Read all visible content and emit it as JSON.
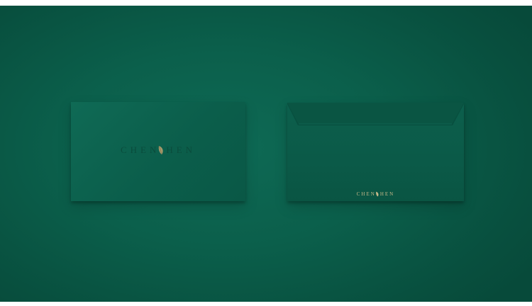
{
  "front_envelope": {
    "logo_left": "CHEN",
    "logo_right": "HEN"
  },
  "back_envelope": {
    "logo_left": "CHEN",
    "logo_right": "HEN"
  },
  "colors": {
    "background": "#0b5f4b",
    "envelope": "#0b5e4b",
    "logo_dark": "#0a4c3c",
    "logo_gold": "#c9b98a"
  },
  "icons": {
    "logo_mark": "leaf-icon"
  }
}
